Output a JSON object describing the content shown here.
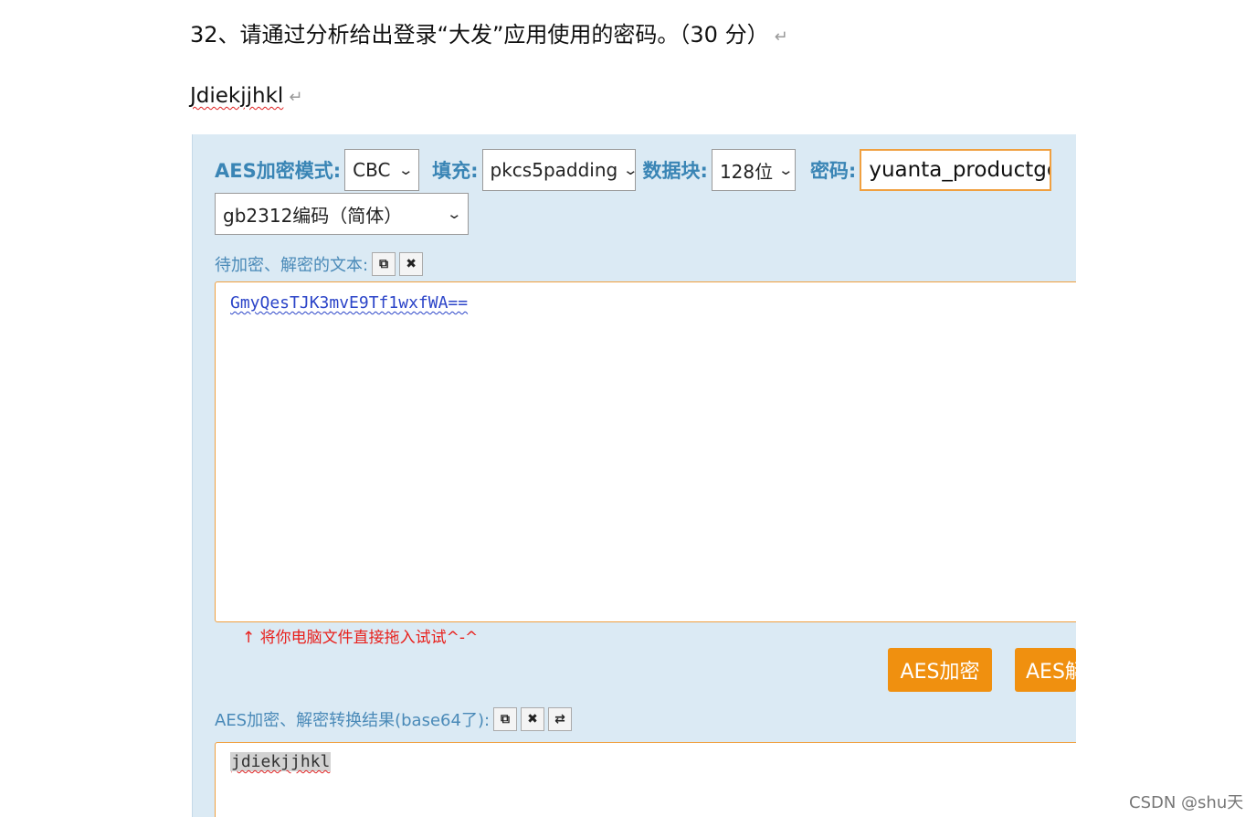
{
  "question": {
    "text": "32、请通过分析给出登录“大发”应用使用的密码。（30 分）",
    "mark": "↵"
  },
  "answer": {
    "text": "Jdiekjjhkl",
    "mark": "↵"
  },
  "aes_tool": {
    "mode_label": "AES加密模式:",
    "mode_value": "CBC",
    "padding_label": "填充:",
    "padding_value": "pkcs5padding",
    "block_label": "数据块:",
    "block_value": "128位",
    "password_label": "密码:",
    "password_value": "yuanta_productgc",
    "encoding_value": "gb2312编码（简体）",
    "input_label": "待加密、解密的文本:",
    "input_value": "GmyQesTJK3mvE9Tf1wxfWA==",
    "drag_hint": "↑ 将你电脑文件直接拖入试试^-^",
    "encrypt_button": "AES加密",
    "decrypt_button": "AES解",
    "result_label": "AES加密、解密转换结果(base64了):",
    "result_value": "jdiekjjhkl"
  },
  "watermark": "CSDN @shu天",
  "colors": {
    "panel_bg": "#dbeaf4",
    "label_blue": "#3a85b5",
    "orange": "#f0900f",
    "hint_red": "#e8201c",
    "cipher_blue": "#2b44c8"
  },
  "icons": [
    "copy-icon",
    "close-icon",
    "swap-icon",
    "chevron-down-icon"
  ]
}
